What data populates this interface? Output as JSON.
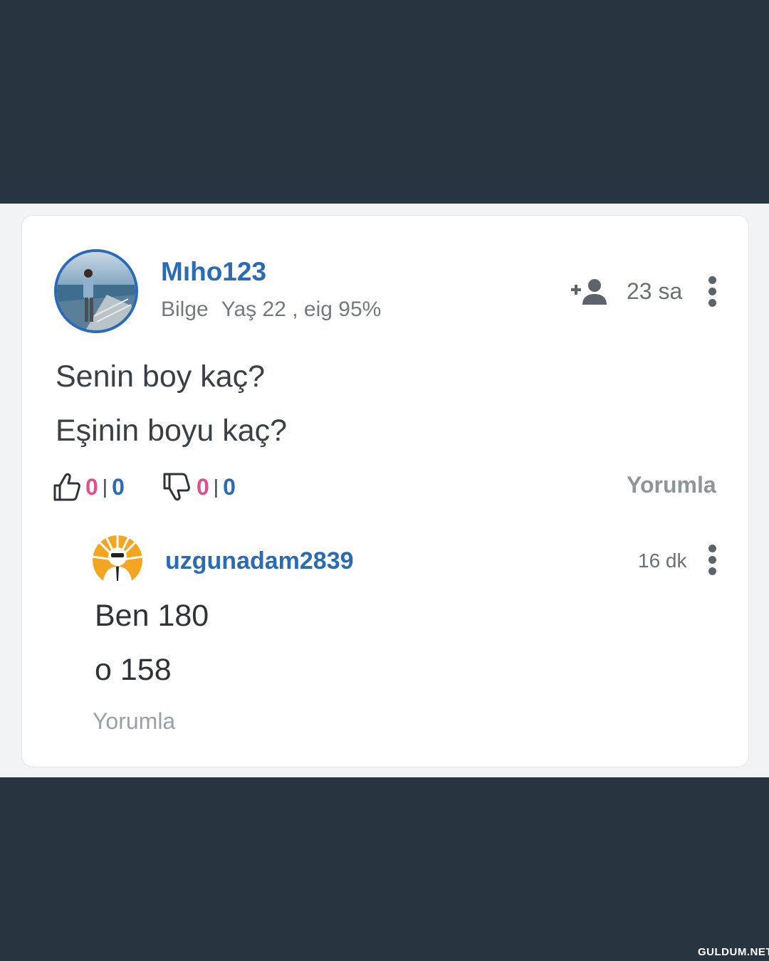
{
  "post": {
    "username": "Mıho123",
    "rank": "Bilge",
    "age_info": "Yaş 22 , eig 95%",
    "time": "23 sa",
    "lines": [
      "Senin boy kaç?",
      "Eşinin boyu kaç?"
    ],
    "likes": {
      "left": "0",
      "sep": "|",
      "right": "0"
    },
    "dislikes": {
      "left": "0",
      "sep": "|",
      "right": "0"
    },
    "comment_label": "Yorumla",
    "add_user_icon": "add-person-icon"
  },
  "reply": {
    "username": "uzgunadam2839",
    "time": "16 dk",
    "lines": [
      "Ben 180",
      "o 158"
    ],
    "comment_label": "Yorumla"
  },
  "watermark": "GULDUM.NET",
  "colors": {
    "background": "#263540",
    "card": "#ffffff",
    "accent_blue": "#2a6bb8",
    "count_pink": "#e0508f",
    "muted_gray": "#8e969c"
  }
}
